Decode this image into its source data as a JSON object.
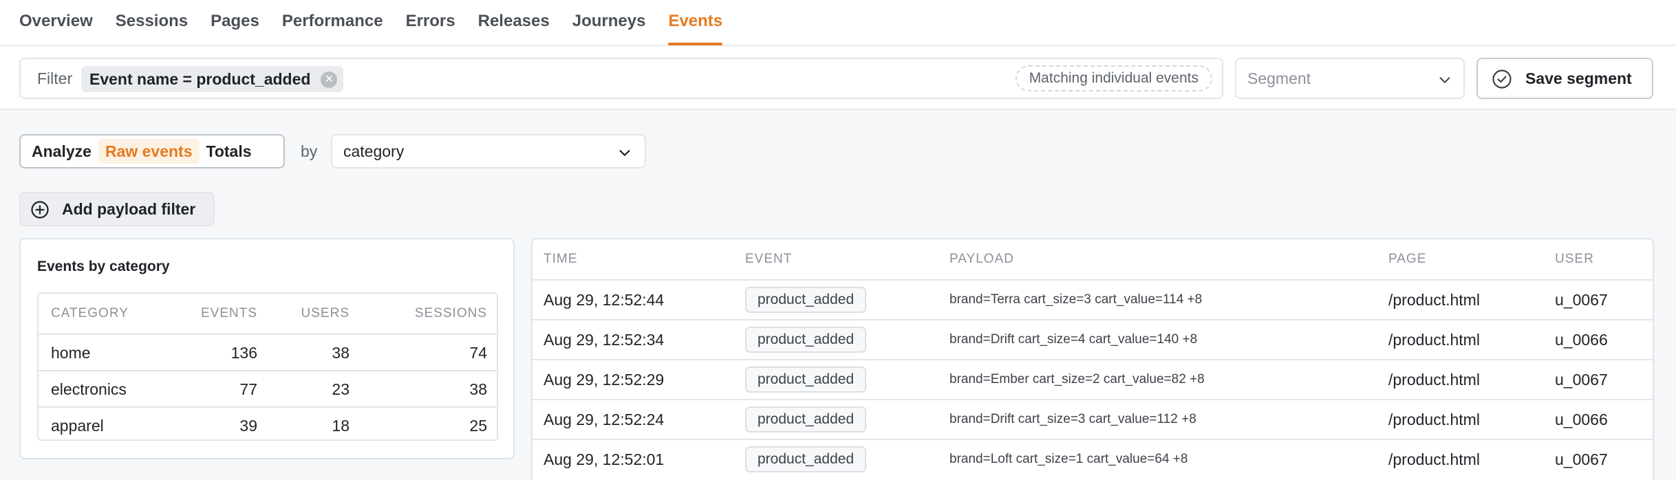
{
  "nav": {
    "tabs": [
      {
        "label": "Overview"
      },
      {
        "label": "Sessions"
      },
      {
        "label": "Pages"
      },
      {
        "label": "Performance"
      },
      {
        "label": "Errors"
      },
      {
        "label": "Releases"
      },
      {
        "label": "Journeys"
      },
      {
        "label": "Events"
      }
    ],
    "active": "Events"
  },
  "filter": {
    "label": "Filter",
    "chip": "Event name = product_added",
    "matching": "Matching individual events"
  },
  "segment": {
    "placeholder": "Segment",
    "save_label": "Save segment"
  },
  "mode": {
    "options": [
      "Analyze",
      "Raw events",
      "Totals"
    ],
    "active": "Raw events"
  },
  "groupby": {
    "label": "by",
    "value": "category"
  },
  "add_payload_filter": "Add payload filter",
  "category_card": {
    "title": "Events by category",
    "columns": [
      "CATEGORY",
      "EVENTS",
      "USERS",
      "SESSIONS"
    ],
    "rows": [
      {
        "category": "home",
        "events": "136",
        "users": "38",
        "sessions": "74"
      },
      {
        "category": "electronics",
        "events": "77",
        "users": "23",
        "sessions": "38"
      },
      {
        "category": "apparel",
        "events": "39",
        "users": "18",
        "sessions": "25"
      }
    ]
  },
  "events_table": {
    "columns": [
      "TIME",
      "EVENT",
      "PAYLOAD",
      "PAGE",
      "USER"
    ],
    "rows": [
      {
        "time": "Aug 29, 12:52:44",
        "event": "product_added",
        "payload": "brand=Terra cart_size=3 cart_value=114 +8",
        "page": "/product.html",
        "user": "u_0067"
      },
      {
        "time": "Aug 29, 12:52:34",
        "event": "product_added",
        "payload": "brand=Drift cart_size=4 cart_value=140 +8",
        "page": "/product.html",
        "user": "u_0066"
      },
      {
        "time": "Aug 29, 12:52:29",
        "event": "product_added",
        "payload": "brand=Ember cart_size=2 cart_value=82 +8",
        "page": "/product.html",
        "user": "u_0067"
      },
      {
        "time": "Aug 29, 12:52:24",
        "event": "product_added",
        "payload": "brand=Drift cart_size=3 cart_value=112 +8",
        "page": "/product.html",
        "user": "u_0066"
      },
      {
        "time": "Aug 29, 12:52:01",
        "event": "product_added",
        "payload": "brand=Loft cart_size=1 cart_value=64 +8",
        "page": "/product.html",
        "user": "u_0067"
      }
    ]
  },
  "colors": {
    "accent": "#e57a1f",
    "accent_bg": "#fdf1e4",
    "border": "#e3e5e8",
    "muted_text": "#8c9199",
    "page_bg": "#f6f7f9"
  },
  "icons": {
    "chip_clear": "close-circle-icon",
    "segment_dropdown": "chevron-down-icon",
    "save_segment": "check-circle-icon",
    "add_payload_filter": "plus-circle-icon"
  }
}
